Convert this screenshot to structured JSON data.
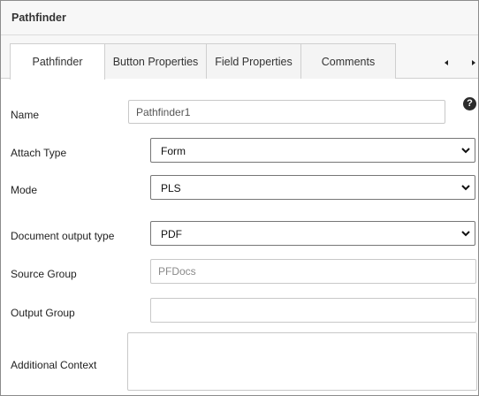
{
  "header": {
    "title": "Pathfinder"
  },
  "tabs": [
    {
      "label": "Pathfinder",
      "active": true
    },
    {
      "label": "Button Properties",
      "active": false
    },
    {
      "label": "Field Properties",
      "active": false
    },
    {
      "label": "Comments",
      "active": false
    }
  ],
  "tab_scroll": {
    "left_icon": "triangle-left-icon",
    "right_icon": "triangle-right-icon"
  },
  "help": {
    "icon": "question-circle-icon",
    "glyph": "?"
  },
  "form": {
    "name": {
      "label": "Name",
      "value": "Pathfinder1"
    },
    "attach_type": {
      "label": "Attach Type",
      "value": "Form"
    },
    "mode": {
      "label": "Mode",
      "value": "PLS"
    },
    "document_output_type": {
      "label": "Document output type",
      "value": "PDF"
    },
    "source_group": {
      "label": "Source Group",
      "placeholder": "PFDocs",
      "value": ""
    },
    "output_group": {
      "label": "Output Group",
      "value": ""
    },
    "additional_context": {
      "label": "Additional Context",
      "value": ""
    }
  }
}
